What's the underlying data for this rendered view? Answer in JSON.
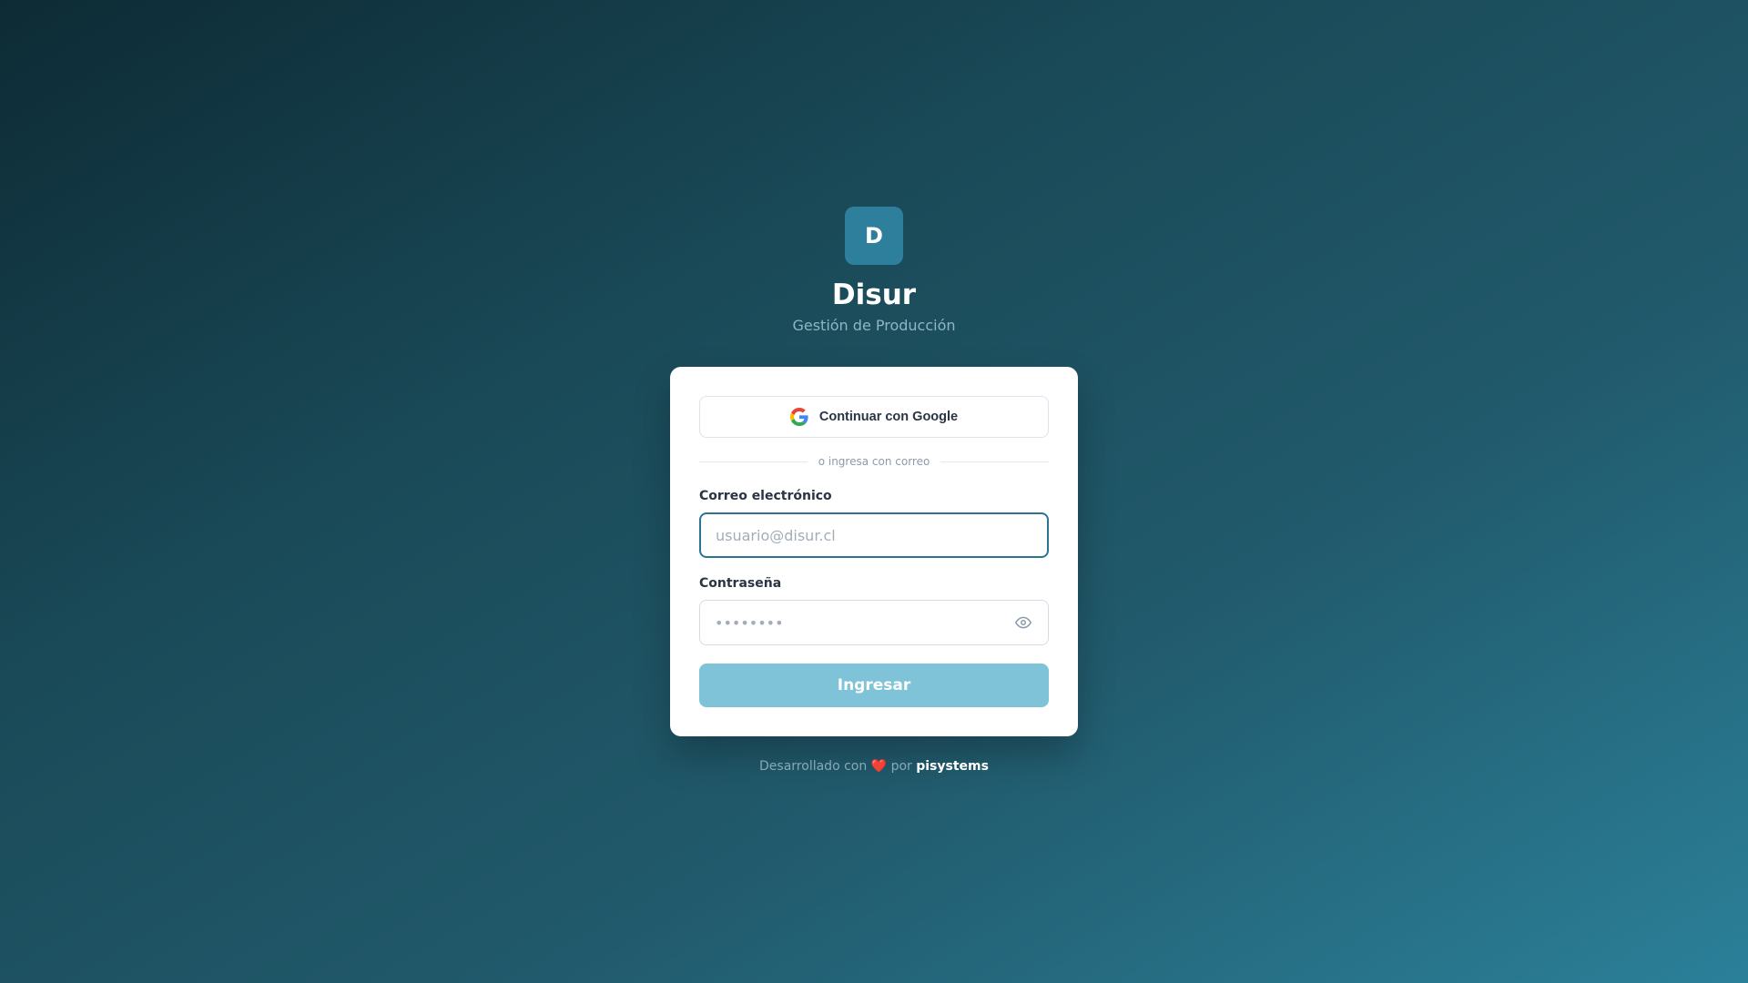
{
  "brand": {
    "logo_letter": "D",
    "title": "Disur",
    "subtitle": "Gestión de Producción",
    "accent_color": "#2e7f9c"
  },
  "login": {
    "google_button_label": "Continuar con Google",
    "google_icon": "google-icon",
    "divider_text": "o ingresa con correo",
    "email_label": "Correo electrónico",
    "email_placeholder": "usuario@disur.cl",
    "email_value": "",
    "password_label": "Contraseña",
    "password_placeholder": "••••••••",
    "password_value": "",
    "password_toggle_icon": "eye-icon",
    "submit_label": "Ingresar",
    "submit_color": "#7fc3d8"
  },
  "footer": {
    "prefix": "Desarrollado con",
    "heart": "❤️",
    "by": "por",
    "company": "pisystems"
  }
}
